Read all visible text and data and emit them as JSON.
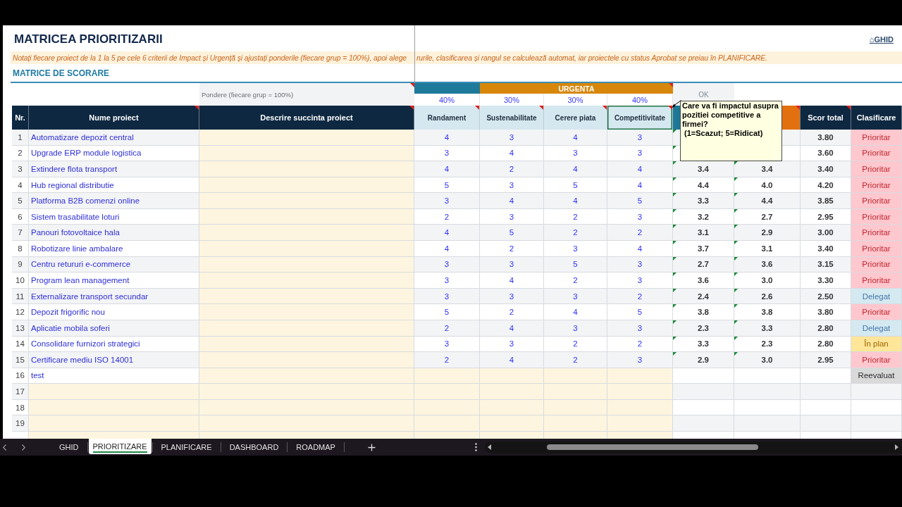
{
  "sheet": {
    "title": "MATRICEA PRIORITIZARII",
    "guide_link": "⌂GHID",
    "instructions": [
      "Notați fiecare proiect de la 1 la 5 pe cele 6 criterii de Impact și Urgență și ajustați ponderile (fiecare grup = 100%), apoi alege",
      "rurile, clasificarea și rangul se calculează automat, iar proiectele cu status Aprobat se preiau în PLANIFICARE."
    ],
    "section_title": "MATRICE DE SCORARE"
  },
  "table": {
    "weights": {
      "label": "Pondere (fiecare grup = 100%)",
      "comment": true,
      "check": "OK"
    },
    "lead_columns": [
      {
        "label": "Nr.",
        "kind": "number",
        "comment": false,
        "selected": false
      },
      {
        "label": "Nume proiect",
        "kind": "name",
        "comment": true,
        "selected": false
      },
      {
        "label": "Descrire succinta proiect",
        "kind": "description",
        "comment": true,
        "selected": false
      }
    ],
    "groups": [
      {
        "color": "#1d7a9a",
        "comment": false,
        "criteria": [
          {
            "label": "Randament",
            "weight": "40%",
            "comment": true,
            "selected": false
          }
        ]
      },
      {
        "label": "URGENTA",
        "color": "#d6870c",
        "comment": true,
        "criteria": [
          {
            "label": "Sustenabilitate",
            "weight": "30%",
            "comment": true,
            "selected": false
          },
          {
            "label": "Cerere piata",
            "weight": "30%",
            "comment": true,
            "selected": false
          },
          {
            "label": "Competitivitate",
            "weight": "40%",
            "comment": true,
            "selected": true
          }
        ]
      }
    ],
    "score_columns": [
      {
        "kind": "impact",
        "comment": false,
        "selected": false
      },
      {
        "kind": "urgency",
        "comment": true,
        "selected": false
      },
      {
        "kind": "total",
        "label": "Scor total",
        "comment": true,
        "selected": false
      }
    ],
    "status_column": {
      "label": "Clasificare",
      "comment": false,
      "selected": false
    },
    "comment_popup": "Care va fi impactul asupra pozitiei competitive a firmei?\n (1=Scazut; 5=Ridicat)",
    "rows": [
      {
        "nr": "1",
        "name": "Automatizare depozit central",
        "scores": [
          "4",
          "3",
          "4",
          "3"
        ],
        "total": "3.80",
        "status": {
          "label": "Prioritar",
          "kind": "priority"
        },
        "flagged": true
      },
      {
        "nr": "2",
        "name": "Upgrade ERP module logistica",
        "scores": [
          "3",
          "4",
          "3",
          "3"
        ],
        "total": "3.60",
        "status": {
          "label": "Prioritar",
          "kind": "priority"
        },
        "flagged": true
      },
      {
        "nr": "3",
        "name": "Extindere flota transport",
        "scores": [
          "4",
          "2",
          "4",
          "4"
        ],
        "impact": "3.4",
        "urgency": "3.4",
        "total": "3.40",
        "status": {
          "label": "Prioritar",
          "kind": "priority"
        },
        "flagged": true
      },
      {
        "nr": "4",
        "name": "Hub regional distributie",
        "scores": [
          "5",
          "3",
          "5",
          "4"
        ],
        "impact": "4.4",
        "urgency": "4.0",
        "total": "4.20",
        "status": {
          "label": "Prioritar",
          "kind": "priority"
        },
        "flagged": true
      },
      {
        "nr": "5",
        "name": "Platforma B2B comenzi online",
        "scores": [
          "3",
          "4",
          "4",
          "5"
        ],
        "impact": "3.3",
        "urgency": "4.4",
        "total": "3.85",
        "status": {
          "label": "Prioritar",
          "kind": "priority"
        },
        "flagged": true
      },
      {
        "nr": "6",
        "name": "Sistem trasabilitate loturi",
        "scores": [
          "2",
          "3",
          "2",
          "3"
        ],
        "impact": "3.2",
        "urgency": "2.7",
        "total": "2.95",
        "status": {
          "label": "Prioritar",
          "kind": "priority"
        },
        "flagged": true
      },
      {
        "nr": "7",
        "name": "Panouri fotovoltaice hala",
        "scores": [
          "4",
          "5",
          "2",
          "2"
        ],
        "impact": "3.1",
        "urgency": "2.9",
        "total": "3.00",
        "status": {
          "label": "Prioritar",
          "kind": "priority"
        },
        "flagged": true
      },
      {
        "nr": "8",
        "name": "Robotizare linie ambalare",
        "scores": [
          "4",
          "2",
          "3",
          "4"
        ],
        "impact": "3.7",
        "urgency": "3.1",
        "total": "3.40",
        "status": {
          "label": "Prioritar",
          "kind": "priority"
        },
        "flagged": true
      },
      {
        "nr": "9",
        "name": "Centru retururi e-commerce",
        "scores": [
          "3",
          "3",
          "5",
          "3"
        ],
        "impact": "2.7",
        "urgency": "3.6",
        "total": "3.15",
        "status": {
          "label": "Prioritar",
          "kind": "priority"
        },
        "flagged": true
      },
      {
        "nr": "10",
        "name": "Program lean management",
        "scores": [
          "3",
          "4",
          "2",
          "3"
        ],
        "impact": "3.6",
        "urgency": "3.0",
        "total": "3.30",
        "status": {
          "label": "Prioritar",
          "kind": "priority"
        },
        "flagged": true
      },
      {
        "nr": "11",
        "name": "Externalizare transport secundar",
        "scores": [
          "3",
          "3",
          "3",
          "2"
        ],
        "impact": "2.4",
        "urgency": "2.6",
        "total": "2.50",
        "status": {
          "label": "Delegat",
          "kind": "delegated"
        },
        "flagged": true
      },
      {
        "nr": "12",
        "name": "Depozit frigorific nou",
        "scores": [
          "5",
          "2",
          "4",
          "5"
        ],
        "impact": "3.8",
        "urgency": "3.8",
        "total": "3.80",
        "status": {
          "label": "Prioritar",
          "kind": "priority"
        },
        "flagged": true
      },
      {
        "nr": "13",
        "name": "Aplicatie mobila soferi",
        "scores": [
          "2",
          "4",
          "3",
          "3"
        ],
        "impact": "2.3",
        "urgency": "3.3",
        "total": "2.80",
        "status": {
          "label": "Delegat",
          "kind": "delegated"
        },
        "flagged": true
      },
      {
        "nr": "14",
        "name": "Consolidare furnizori strategici",
        "scores": [
          "3",
          "3",
          "2",
          "2"
        ],
        "impact": "3.3",
        "urgency": "2.3",
        "total": "2.80",
        "status": {
          "label": "În plan",
          "kind": "planned"
        },
        "flagged": true
      },
      {
        "nr": "15",
        "name": "Certificare mediu ISO 14001",
        "scores": [
          "2",
          "4",
          "2",
          "3"
        ],
        "impact": "2.9",
        "urgency": "3.0",
        "total": "2.95",
        "status": {
          "label": "Prioritar",
          "kind": "priority"
        },
        "flagged": true
      },
      {
        "nr": "16",
        "name": "test",
        "status": {
          "label": "Reevaluat",
          "kind": "review"
        },
        "flagged": false
      },
      {
        "nr": "17",
        "flagged": false
      },
      {
        "nr": "18",
        "flagged": false
      },
      {
        "nr": "19",
        "flagged": false
      }
    ]
  },
  "sheet_tabs": [
    {
      "label": "GHID",
      "selected": false
    },
    {
      "label": "PRIORITIZARE",
      "selected": true
    },
    {
      "label": "PLANIFICARE",
      "selected": false
    },
    {
      "label": "DASHBOARD",
      "selected": false
    },
    {
      "label": "ROADMAP",
      "selected": false
    }
  ]
}
